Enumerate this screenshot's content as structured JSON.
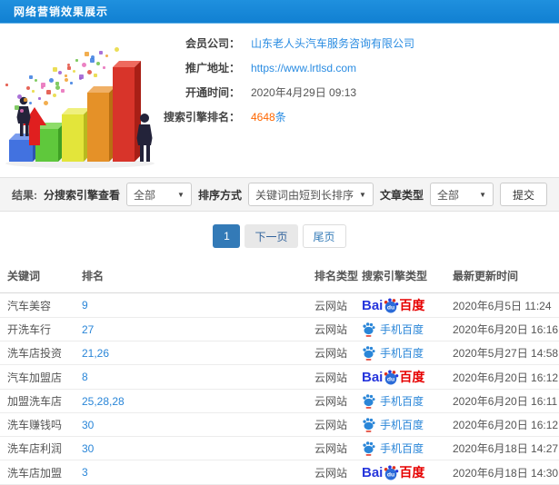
{
  "header": {
    "title": "网络营销效果展示"
  },
  "info": {
    "fields": [
      {
        "label": "会员公司：",
        "value": "山东老人头汽车服务咨询有限公司",
        "style": "link"
      },
      {
        "label": "推广地址：",
        "value": "https://www.lrtlsd.com",
        "style": "link"
      },
      {
        "label": "开通时间：",
        "value": "2020年4月29日 09:13",
        "style": "plain"
      },
      {
        "label": "搜索引擎排名：",
        "value": "4648",
        "suffix": "条",
        "style": "count"
      }
    ],
    "illustration": {
      "name": "3d-bar-growth-clipart",
      "bar_colors": [
        "#4272e0",
        "#5fc83c",
        "#e3e53a",
        "#e59128",
        "#d8342a"
      ],
      "confetti_colors": [
        "#e24a3b",
        "#e86cb8",
        "#6cc24a",
        "#3a7de0",
        "#f0a030",
        "#9b59d0",
        "#e8d83a"
      ]
    }
  },
  "filters": {
    "section_label": "结果:",
    "engine_label": "分搜索引擎查看",
    "engine_value": "全部",
    "sort_label": "排序方式",
    "sort_value": "关键词由短到长排序",
    "article_label": "文章类型",
    "article_value": "全部",
    "submit_label": "提交"
  },
  "pagination": {
    "current": "1",
    "next": "下一页",
    "last": "尾页"
  },
  "table": {
    "headers": [
      "关键词",
      "排名",
      "排名类型",
      "搜索引擎类型",
      "最新更新时间"
    ],
    "baidu_logo": {
      "latin": "Bai",
      "du": "du",
      "cn": "百度"
    },
    "rows": [
      {
        "keyword": "汽车美容",
        "rank": "9",
        "rank_type": "云网站",
        "engine": "baidu",
        "engine_label": "百度",
        "time": "2020年6月5日 11:24"
      },
      {
        "keyword": "开洗车行",
        "rank": "27",
        "rank_type": "云网站",
        "engine": "mobile-baidu",
        "engine_label": "手机百度",
        "time": "2020年6月20日 16:16"
      },
      {
        "keyword": "洗车店投资",
        "rank": "21,26",
        "rank_type": "云网站",
        "engine": "mobile-baidu",
        "engine_label": "手机百度",
        "time": "2020年5月27日 14:58"
      },
      {
        "keyword": "汽车加盟店",
        "rank": "8",
        "rank_type": "云网站",
        "engine": "baidu",
        "engine_label": "百度",
        "time": "2020年6月20日 16:12"
      },
      {
        "keyword": "加盟洗车店",
        "rank": "25,28,28",
        "rank_type": "云网站",
        "engine": "mobile-baidu",
        "engine_label": "手机百度",
        "time": "2020年6月20日 16:11"
      },
      {
        "keyword": "洗车赚钱吗",
        "rank": "30",
        "rank_type": "云网站",
        "engine": "mobile-baidu",
        "engine_label": "手机百度",
        "time": "2020年6月20日 16:12"
      },
      {
        "keyword": "洗车店利润",
        "rank": "30",
        "rank_type": "云网站",
        "engine": "mobile-baidu",
        "engine_label": "手机百度",
        "time": "2020年6月18日 14:27"
      },
      {
        "keyword": "洗车店加盟",
        "rank": "3",
        "rank_type": "云网站",
        "engine": "baidu",
        "engine_label": "百度",
        "time": "2020年6月18日 14:30"
      }
    ]
  },
  "colors": {
    "header_bg": "#1385d8",
    "link_blue": "#2a8ce2",
    "count_orange": "#ff6600",
    "active_page_bg": "#337ab7",
    "baidu_blue": "#2636dc",
    "baidu_red": "#e60000",
    "mobile_baidu_blue": "#2a86d8"
  }
}
